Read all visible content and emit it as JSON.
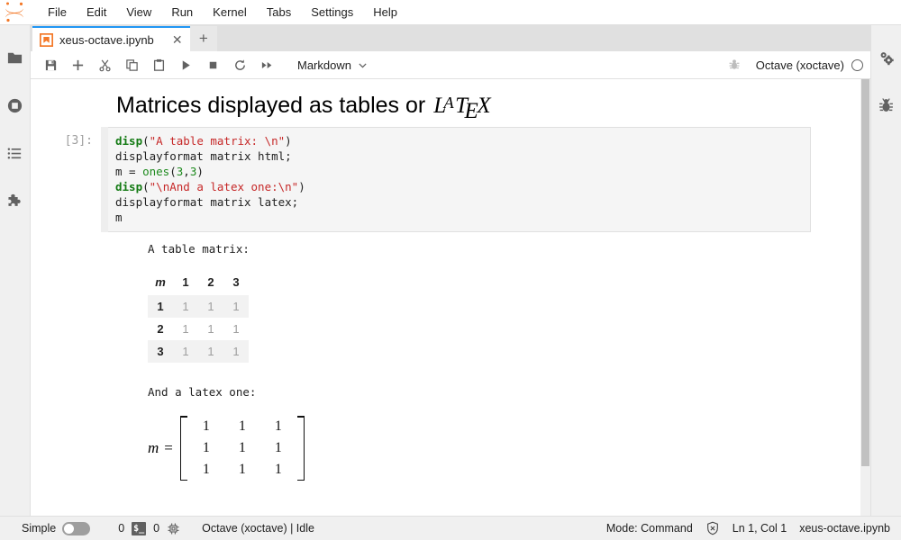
{
  "app": {
    "logo_name": "jupyter-logo"
  },
  "menubar": {
    "items": [
      {
        "label": "File",
        "name": "menu-file"
      },
      {
        "label": "Edit",
        "name": "menu-edit"
      },
      {
        "label": "View",
        "name": "menu-view"
      },
      {
        "label": "Run",
        "name": "menu-run"
      },
      {
        "label": "Kernel",
        "name": "menu-kernel"
      },
      {
        "label": "Tabs",
        "name": "menu-tabs"
      },
      {
        "label": "Settings",
        "name": "menu-settings"
      },
      {
        "label": "Help",
        "name": "menu-help"
      }
    ]
  },
  "left_sidebar": {
    "items": [
      {
        "icon": "folder-icon",
        "name": "sidebar-item-file-browser"
      },
      {
        "icon": "running-sessions-icon",
        "name": "sidebar-item-running"
      },
      {
        "icon": "commands-list-icon",
        "name": "sidebar-item-commands"
      },
      {
        "icon": "puzzle-piece-icon",
        "name": "sidebar-item-extensions"
      }
    ]
  },
  "right_sidebar": {
    "items": [
      {
        "icon": "gears-icon",
        "name": "sidebar-item-property-inspector"
      },
      {
        "icon": "bug-icon",
        "name": "sidebar-item-debugger"
      }
    ]
  },
  "tabbar": {
    "tab_label": "xeus-octave.ipynb",
    "tab_icon": "notebook-icon",
    "close_glyph": "✕",
    "add_glyph": "+"
  },
  "toolbar": {
    "buttons": [
      {
        "icon": "save-icon",
        "name": "save-button"
      },
      {
        "icon": "add-cell-icon",
        "name": "insert-cell-button"
      },
      {
        "icon": "cut-icon",
        "name": "cut-cells-button"
      },
      {
        "icon": "copy-icon",
        "name": "copy-cells-button"
      },
      {
        "icon": "paste-icon",
        "name": "paste-cells-button"
      },
      {
        "icon": "run-icon",
        "name": "run-cell-button"
      },
      {
        "icon": "stop-icon",
        "name": "interrupt-kernel-button"
      },
      {
        "icon": "restart-icon",
        "name": "restart-kernel-button"
      },
      {
        "icon": "fast-forward-icon",
        "name": "restart-and-run-all-button"
      }
    ],
    "cell_type": "Markdown",
    "chevron": "⌄",
    "debugger_icon": "bug-icon",
    "kernel_name": "Octave (xoctave)",
    "kernel_status_icon": "kernel-idle-circle"
  },
  "notebook": {
    "markdown_cell": {
      "heading_text": "Matrices displayed as tables or",
      "latex_logo": {
        "l": "L",
        "a": "A",
        "t": "T",
        "e": "E",
        "x": "X"
      }
    },
    "code_cell": {
      "prompt": "[3]:",
      "lines": [
        [
          {
            "t": "disp",
            "c": "fn"
          },
          {
            "t": "(",
            "c": ""
          },
          {
            "t": "\"A table matrix: \\n\"",
            "c": "str"
          },
          {
            "t": ")",
            "c": ""
          }
        ],
        [
          {
            "t": "displayformat matrix html;",
            "c": ""
          }
        ],
        [
          {
            "t": "m = ",
            "c": ""
          },
          {
            "t": "ones",
            "c": "builtin"
          },
          {
            "t": "(",
            "c": ""
          },
          {
            "t": "3",
            "c": "num"
          },
          {
            "t": ",",
            "c": ""
          },
          {
            "t": "3",
            "c": "num"
          },
          {
            "t": ")",
            "c": ""
          }
        ],
        [
          {
            "t": "disp",
            "c": "fn"
          },
          {
            "t": "(",
            "c": ""
          },
          {
            "t": "\"\\nAnd a latex one:\\n\"",
            "c": "str"
          },
          {
            "t": ")",
            "c": ""
          }
        ],
        [
          {
            "t": "displayformat matrix latex;",
            "c": ""
          }
        ],
        [
          {
            "t": "m",
            "c": ""
          }
        ]
      ]
    },
    "outputs": {
      "stream_1": "A table matrix:",
      "table": {
        "corner_label": "m",
        "column_headers": [
          "1",
          "2",
          "3"
        ],
        "row_headers": [
          "1",
          "2",
          "3"
        ],
        "rows": [
          [
            "1",
            "1",
            "1"
          ],
          [
            "1",
            "1",
            "1"
          ],
          [
            "1",
            "1",
            "1"
          ]
        ]
      },
      "stream_2": "And a latex one:",
      "latex_matrix": {
        "lhs": "m",
        "equals": "=",
        "values": [
          [
            "1",
            "1",
            "1"
          ],
          [
            "1",
            "1",
            "1"
          ],
          [
            "1",
            "1",
            "1"
          ]
        ]
      }
    }
  },
  "statusbar": {
    "simple_label": "Simple",
    "simple_toggle_on": false,
    "terminals_count": "0",
    "terminal_badge": "$_",
    "kernels_count": "0",
    "kernel_icon": "kernel-chip-icon",
    "kernel_status": "Octave (xoctave) | Idle",
    "mode": "Mode: Command",
    "trust_icon": "untrusted-shield-icon",
    "cursor_position": "Ln 1, Col 1",
    "file_name": "xeus-octave.ipynb"
  },
  "colors": {
    "accent_blue": "#2196f3",
    "jupyter_orange": "#f37726",
    "code_string": "#c62828",
    "code_function": "#137a13",
    "chrome_gray": "#f0f0f0"
  }
}
